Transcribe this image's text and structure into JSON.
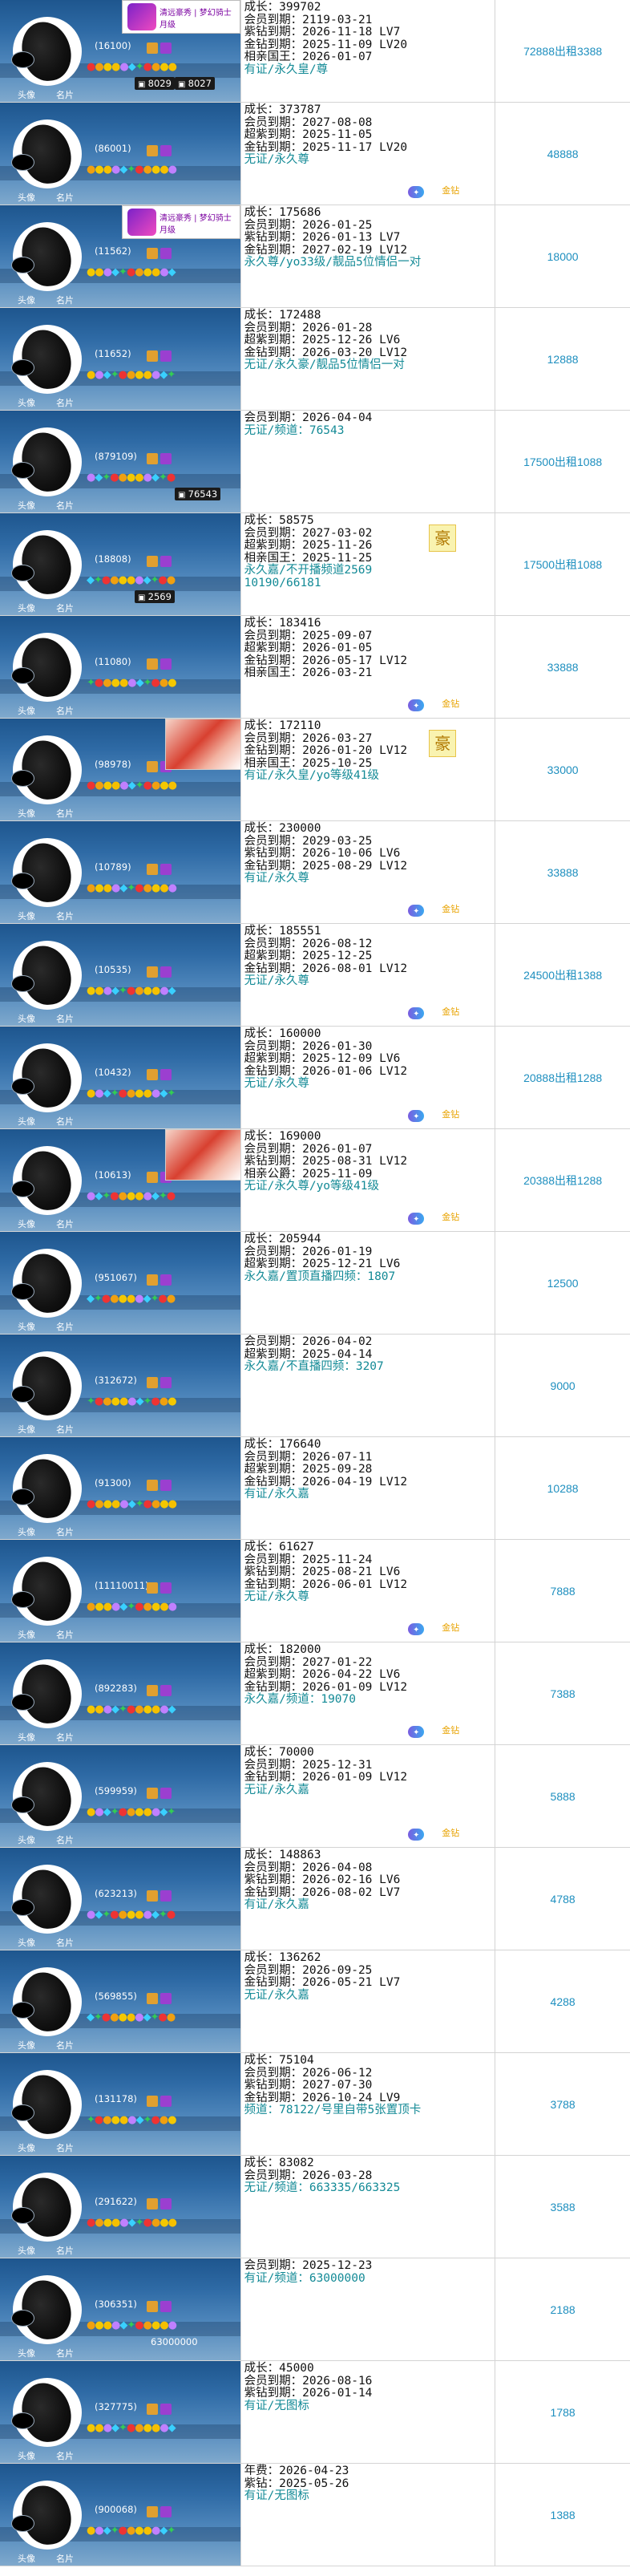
{
  "rows": [
    {
      "num": "(16100)",
      "banner": "清远豪秀 | 梦幻骑士 月级",
      "chip": "8027",
      "chip2": "8029",
      "lines": [
        "成长：399702",
        "会员到期：2119-03-21",
        "紫钻到期：2026-11-18 LV7",
        "金钻到期：2025-11-09 LV20",
        "相亲国王：2026-01-07"
      ],
      "tl": [
        "有证/永久皇/尊"
      ],
      "price": "72888出租3388"
    },
    {
      "num": "(86001)",
      "lines": [
        "成长：373787",
        "会员到期：2027-08-08",
        "超紫到期：2025-11-05",
        "金钻到期：2025-11-17 LV20"
      ],
      "tl": [
        "无证/永久尊"
      ],
      "gold": "金钻",
      "price": "48888"
    },
    {
      "num": "(11562)",
      "banner": "清远豪秀 | 梦幻骑士 月级",
      "lines": [
        "成长：175686",
        "会员到期：2026-01-25",
        "紫钻到期：2026-01-13 LV7",
        "金钻到期：2027-02-19 LV12"
      ],
      "tl": [
        "永久尊/yo33级/靓品5位情侣一对"
      ],
      "price": "18000"
    },
    {
      "num": "(11652)",
      "lines": [
        "成长：172488",
        "会员到期：2026-01-28",
        "超紫到期：2025-12-26 LV6",
        "金钻到期：2026-03-20 LV12"
      ],
      "tl": [
        "无证/永久豪/靓品5位情侣一对"
      ],
      "price": "12888"
    },
    {
      "num": "(879109)",
      "chip": "76543",
      "lines": [
        "会员到期：2026-04-04"
      ],
      "tl": [
        "无证/频道：76543"
      ],
      "price": "17500出租1088"
    },
    {
      "num": "(18808)",
      "chip2": "2569",
      "lines": [
        "成长：58575",
        "会员到期：2027-03-02",
        "超紫到期：2025-11-26",
        "相亲国王：2025-11-25"
      ],
      "tl": [
        "永久嘉/不开播频道2569",
        "10190/66181"
      ],
      "hanzi": "豪",
      "price": "17500出租1088"
    },
    {
      "num": "(11080)",
      "lines": [
        "成长：183416",
        "会员到期：2025-09-07",
        "超紫到期：2026-01-05",
        "金钻到期：2026-05-17 LV12",
        "相亲国王：2026-03-21"
      ],
      "gold": "金钻",
      "price": "33888"
    },
    {
      "num": "(98978)",
      "photo": true,
      "lines": [
        "成长：172110",
        "会员到期：2026-03-27",
        "金钻到期：2026-01-20 LV12",
        "相亲国王：2025-10-25"
      ],
      "tl": [
        "有证/永久皇/yo等级41级"
      ],
      "hanzi": "豪",
      "price": "33000"
    },
    {
      "num": "(10789)",
      "lines": [
        "成长：230000",
        "会员到期：2029-03-25",
        "紫钻到期：2026-10-06 LV6",
        "金钻到期：2025-08-29 LV12"
      ],
      "tl": [
        "有证/永久尊"
      ],
      "gold": "金钻",
      "price": "33888"
    },
    {
      "num": "(10535)",
      "lines": [
        "成长：185551",
        "会员到期：2026-08-12",
        "超紫到期：2025-12-25",
        "金钻到期：2026-08-01 LV12"
      ],
      "tl": [
        "无证/永久尊"
      ],
      "gold": "金钻",
      "price": "24500出租1388"
    },
    {
      "num": "(10432)",
      "lines": [
        "成长：160000",
        "会员到期：2026-01-30",
        "超紫到期：2025-12-09 LV6",
        "金钻到期：2026-01-06 LV12"
      ],
      "tl": [
        "无证/永久尊"
      ],
      "gold": "金钻",
      "price": "20888出租1288"
    },
    {
      "num": "(10613)",
      "photo": true,
      "lines": [
        "成长：169000",
        "会员到期：2026-01-07",
        "紫钻到期：2025-08-31 LV12",
        "相亲公爵：2025-11-09"
      ],
      "tl": [
        "无证/永久尊/yo等级41级"
      ],
      "gold": "金钻",
      "price": "20388出租1288"
    },
    {
      "num": "(951067)",
      "lines": [
        "成长：205944",
        "会员到期：2026-01-19",
        "超紫到期：2025-12-21 LV6"
      ],
      "tl": [
        "永久嘉/置顶直播四频：1807"
      ],
      "price": "12500"
    },
    {
      "num": "(312672)",
      "lines": [
        "会员到期：2026-04-02",
        "超紫到期：2025-04-14"
      ],
      "tl": [
        "永久嘉/不直播四频：3207"
      ],
      "price": "9000"
    },
    {
      "num": "(91300)",
      "lines": [
        "成长：176640",
        "会员到期：2026-07-11",
        "超紫到期：2025-09-28",
        "金钻到期：2026-04-19 LV12"
      ],
      "tl": [
        "有证/永久嘉"
      ],
      "price": "10288"
    },
    {
      "num": "(11110011)",
      "lines": [
        "成长：61627",
        "会员到期：2025-11-24",
        "紫钻到期：2025-08-21 LV6",
        "金钻到期：2026-06-01 LV12"
      ],
      "tl": [
        "无证/永久尊"
      ],
      "gold": "金钻",
      "price": "7888"
    },
    {
      "num": "(892283)",
      "lines": [
        "成长：182000",
        "会员到期：2027-01-22",
        "超紫到期：2026-04-22 LV6",
        "金钻到期：2026-01-09 LV12"
      ],
      "tl": [
        "永久嘉/频道：19070"
      ],
      "gold": "金钻",
      "price": "7388"
    },
    {
      "num": "(599959)",
      "lines": [
        "成长：70000",
        "会员到期：2025-12-31",
        "金钻到期：2026-01-09 LV12"
      ],
      "tl": [
        "无证/永久嘉"
      ],
      "gold": "金钻",
      "price": "5888"
    },
    {
      "num": "(623213)",
      "lines": [
        "成长：148863",
        "会员到期：2026-04-08",
        "紫钻到期：2026-02-16 LV6",
        "金钻到期：2026-08-02 LV7"
      ],
      "tl": [
        "有证/永久嘉"
      ],
      "price": "4788"
    },
    {
      "num": "(569855)",
      "lines": [
        "成长：136262",
        "会员到期：2026-09-25",
        "金钻到期：2026-05-21 LV7"
      ],
      "tl": [
        "无证/永久嘉"
      ],
      "price": "4288"
    },
    {
      "num": "(131178)",
      "lines": [
        "成长：75104",
        "会员到期：2026-06-12",
        "紫钻到期：2027-07-30",
        "金钻到期：2026-10-24 LV9"
      ],
      "tl": [
        "频道：78122/号里自带5张置顶卡"
      ],
      "price": "3788"
    },
    {
      "num": "(291622)",
      "lines": [
        "成长：83082",
        "会员到期：2026-03-28"
      ],
      "tl": [
        "无证/频道：663335/663325"
      ],
      "price": "3588"
    },
    {
      "num": "(306351)",
      "chip3": "63000000",
      "lines": [
        "会员到期：2025-12-23"
      ],
      "tl": [
        "有证/频道：63000000"
      ],
      "price": "2188"
    },
    {
      "num": "(327775)",
      "lines": [
        "成长：45000",
        "会员到期：2026-08-16",
        "紫钻到期：2026-01-14"
      ],
      "tl": [
        "有证/无图标"
      ],
      "price": "1788"
    },
    {
      "num": "(900068)",
      "lines": [
        "年费：2026-04-23",
        "紫钻：2025-05-26"
      ],
      "tl": [
        "有证/无图标"
      ],
      "price": "1388"
    }
  ],
  "labels": {
    "avatar": "头像",
    "card": "名片"
  }
}
